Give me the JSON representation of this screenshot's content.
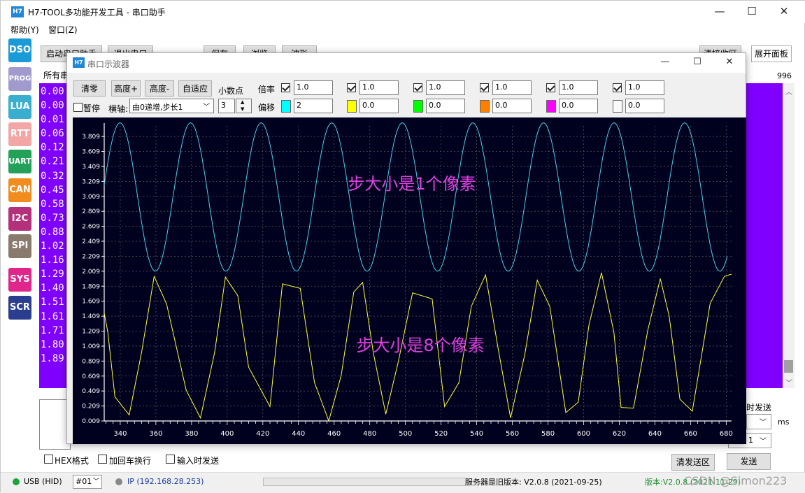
{
  "main_window": {
    "logo": "H7",
    "title": "H7-TOOL多功能开发工具 - 串口助手",
    "menu": [
      "帮助(Y)",
      "窗口(Z)"
    ],
    "controls": {
      "minimize": "—",
      "maximize": "☐",
      "close": "✕"
    }
  },
  "sidebar": [
    {
      "label": "DSO",
      "color": "#1a9ad6"
    },
    {
      "label": "PROG",
      "color": "#a09bcc"
    },
    {
      "label": "LUA",
      "color": "#3aaecf"
    },
    {
      "label": "RTT",
      "color": "#f2a6a6"
    },
    {
      "label": "UART",
      "color": "#23a05a"
    },
    {
      "label": "CAN",
      "color": "#f28c1e"
    },
    {
      "label": "I2C",
      "color": "#b4307a"
    },
    {
      "label": "SPI",
      "color": "#8a7a6e"
    },
    {
      "label": "SYS",
      "color": "#e0268a"
    },
    {
      "label": "SCR",
      "color": "#2b3d8f"
    }
  ],
  "toolbar": {
    "start": "启动串口助手",
    "exit": "退出串口",
    "save": "保存",
    "browse": "浏览",
    "wave": "波形",
    "clear_recv": "清接收区",
    "expand": "展开面板"
  },
  "recv": {
    "header": "所有串",
    "count": "996",
    "lines": [
      "0.00",
      "0.00",
      "0.01",
      "0.06",
      "0.12",
      "0.21",
      "0.32",
      "0.45",
      "0.58",
      "0.73",
      "0.88",
      "1.02",
      "1.16",
      "1.29",
      "1.40",
      "1.51",
      "1.61",
      "1.71",
      "1.80",
      "1.89"
    ]
  },
  "send": {
    "hex": "HEX格式",
    "crlf": "加回车换行",
    "input_send": "输入时发送",
    "timed": "时发送",
    "ms": "ms",
    "stepper_val": "1",
    "clear_send": "清发送区",
    "send": "发送"
  },
  "statusbar": {
    "usb": "USB (HID)",
    "port": "#01",
    "ip": "IP (192.168.28.253)",
    "server": "服务器是旧版本: V2.0.8 (2021-09-25)",
    "version": "版本:V2.0.8 (2021-11-29)",
    "watermark": "CSDN @Simon223"
  },
  "scope": {
    "logo": "H7",
    "title": "串口示波器",
    "clear": "清零",
    "height_plus": "高度+",
    "height_minus": "高度-",
    "auto": "自适应",
    "decimals_label": "小数点",
    "decimals": "3",
    "pause": "暂停",
    "xaxis_label": "横轴:",
    "xaxis_mode": "由0递增,步长1",
    "scale_label": "倍率",
    "offset_label": "偏移",
    "channels": [
      {
        "scale": "1.0",
        "offset": "2",
        "color": "#00ffff",
        "enabled": true
      },
      {
        "scale": "1.0",
        "offset": "0.0",
        "color": "#ffff00",
        "enabled": true
      },
      {
        "scale": "1.0",
        "offset": "0.0",
        "color": "#00ff00",
        "enabled": true
      },
      {
        "scale": "1.0",
        "offset": "0.0",
        "color": "#ff8000",
        "enabled": true
      },
      {
        "scale": "1.0",
        "offset": "0.0",
        "color": "#ff00ff",
        "enabled": true
      },
      {
        "scale": "1.0",
        "offset": "0.0",
        "color": "#ffffff",
        "enabled": true
      }
    ]
  },
  "chart_data": {
    "type": "line",
    "xlim": [
      331,
      683
    ],
    "ylim": [
      0.009,
      3.95
    ],
    "x_ticks": [
      340,
      360,
      380,
      400,
      420,
      440,
      460,
      480,
      500,
      520,
      540,
      560,
      580,
      600,
      620,
      640,
      660,
      680
    ],
    "y_ticks": [
      "0.009",
      "0.209",
      "0.409",
      "0.609",
      "0.809",
      "1.009",
      "1.209",
      "1.409",
      "1.609",
      "1.809",
      "2.009",
      "2.209",
      "2.409",
      "2.609",
      "2.809",
      "3.009",
      "3.209",
      "3.409",
      "3.609",
      "3.809"
    ],
    "grid": true,
    "series": [
      {
        "color": "#45d4e8",
        "center": 3.0,
        "amplitude": 0.99,
        "period": 39.6,
        "phase_x": 331,
        "start_value": 3.16,
        "step": 1
      },
      {
        "color": "#ffff33",
        "values_x": [
          331,
          333,
          337,
          345,
          352,
          359,
          366,
          377,
          385,
          393,
          399,
          406,
          412,
          424,
          431,
          441,
          449,
          457,
          464,
          471,
          476,
          482,
          489,
          496,
          504,
          515,
          522,
          530,
          537,
          545,
          552,
          559,
          567,
          574,
          581,
          590,
          597,
          603,
          610,
          617,
          621,
          628,
          636,
          643,
          648,
          654,
          661,
          671,
          679,
          683
        ],
        "values_y": [
          1.45,
          1.2,
          0.33,
          0.09,
          0.93,
          1.94,
          1.57,
          0.42,
          0.05,
          0.93,
          1.93,
          1.68,
          0.73,
          0.2,
          1.84,
          1.78,
          0.52,
          0.01,
          0.62,
          1.73,
          1.86,
          0.92,
          0.1,
          0.8,
          1.72,
          1.64,
          0.2,
          0.52,
          1.54,
          1.96,
          0.98,
          0.05,
          0.9,
          1.89,
          1.54,
          0.12,
          0.26,
          1.29,
          1.99,
          1.19,
          0.19,
          0.18,
          1.22,
          1.91,
          1.41,
          0.3,
          0.14,
          1.58,
          1.94,
          1.97
        ]
      },
      {
        "color": "#00ff00",
        "values_x": [],
        "values_y": []
      }
    ],
    "annotations": [
      "步大小是1个像素",
      "步大小是8个像素"
    ]
  }
}
